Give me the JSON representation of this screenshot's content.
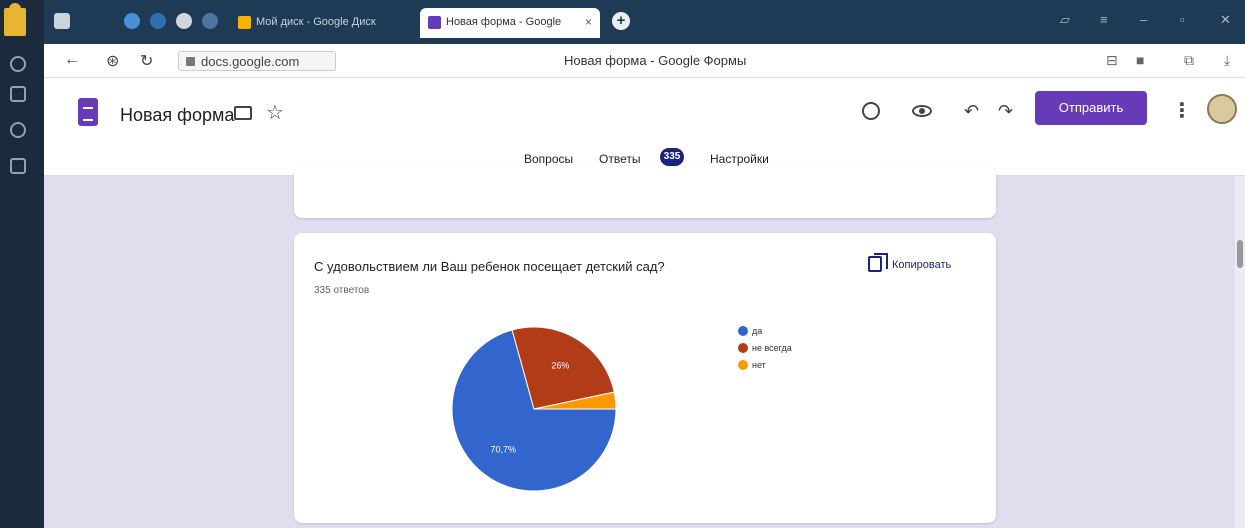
{
  "browser": {
    "tabs": [
      {
        "label": "Мой диск - Google Диск"
      },
      {
        "label": "Новая форма - Google",
        "close": "×"
      }
    ],
    "new_tab": "+",
    "url": "docs.google.com",
    "page_title": "Новая форма - Google Формы"
  },
  "form": {
    "title": "Новая форма",
    "send_label": "Отправить",
    "tabs": {
      "questions": "Вопросы",
      "responses": "Ответы",
      "responses_count": "335",
      "settings": "Настройки"
    }
  },
  "card": {
    "question": "С удовольствием ли Ваш ребенок посещает детский сад?",
    "response_count": "335 ответов",
    "copy_label": "Копировать"
  },
  "chart_data": {
    "type": "pie",
    "labels": [
      "да",
      "не всегда",
      "нет"
    ],
    "values": [
      70.7,
      26.0,
      3.3
    ],
    "slice_labels": [
      "70,7%",
      "26%",
      ""
    ],
    "colors": [
      "#3366cc",
      "#b23c17",
      "#ff9900"
    ],
    "legend_position": "right"
  }
}
